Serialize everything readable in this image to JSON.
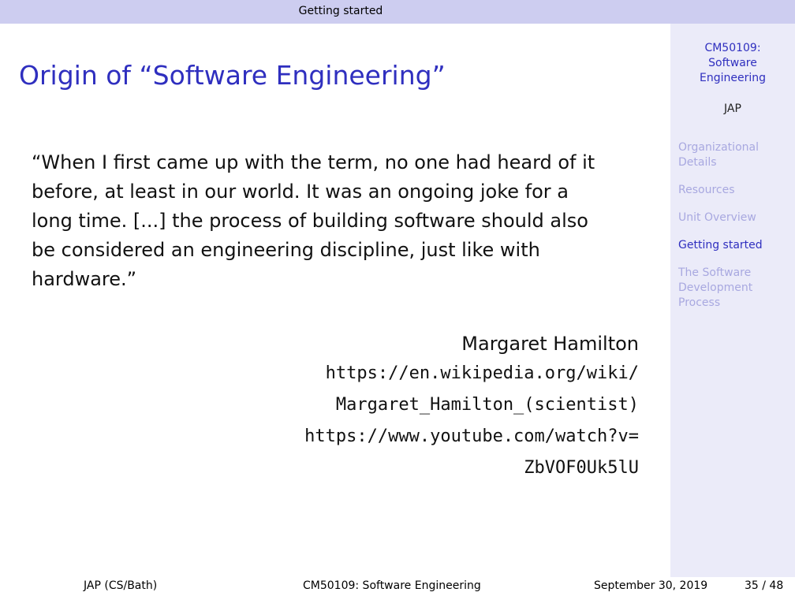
{
  "header": {
    "section": "Getting started"
  },
  "sidebar": {
    "title": "CM50109:\nSoftware\nEngineering",
    "author": "JAP",
    "items": [
      {
        "label": "Organizational\nDetails"
      },
      {
        "label": "Resources"
      },
      {
        "label": "Unit Overview"
      },
      {
        "label": "Getting started"
      },
      {
        "label": "The Software\nDevelopment\nProcess"
      }
    ]
  },
  "slide": {
    "title": "Origin of “Software Engineering”",
    "quote": "“When I first came up with the term, no one had heard of it\nbefore, at least in our world. It was an ongoing joke for a\nlong time. [...] the process of building software should also\nbe considered an engineering discipline, just like with\nhardware.”",
    "attribution": {
      "name": "Margaret Hamilton",
      "link1": "https://en.wikipedia.org/wiki/\nMargaret_Hamilton_(scientist)",
      "link2": "https://www.youtube.com/watch?v=\nZbVOF0Uk5lU"
    }
  },
  "footer": {
    "author": "JAP (CS/Bath)",
    "course": "CM50109: Software Engineering",
    "date": "September 30, 2019",
    "page": "35 / 48"
  }
}
